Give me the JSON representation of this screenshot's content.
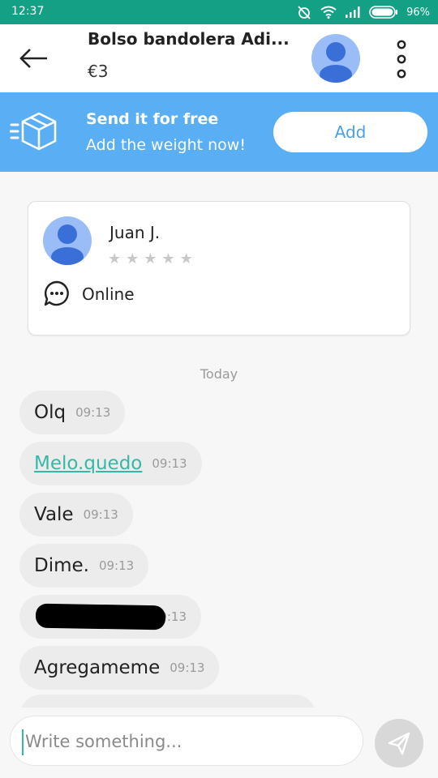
{
  "status_bar": {
    "time": "12:37",
    "battery": "96%"
  },
  "header": {
    "title": "Bolso bandolera Adi...",
    "price": "€3"
  },
  "promo": {
    "title": "Send it for free",
    "subtitle": "Add the weight now!",
    "button": "Add"
  },
  "seller": {
    "name": "Juan J.",
    "status": "Online",
    "stars": [
      "★",
      "★",
      "★",
      "★",
      "★"
    ]
  },
  "chat": {
    "date_label": "Today",
    "messages": [
      {
        "text": "Olq",
        "time": "09:13",
        "link": false
      },
      {
        "text": "Melo.quedo",
        "time": "09:13",
        "link": true
      },
      {
        "text": "Vale",
        "time": "09:13",
        "link": false
      },
      {
        "text": "Dime.",
        "time": "09:13",
        "link": false
      },
      {
        "text": "",
        "time": "9:13",
        "link": false
      },
      {
        "text": "Agregameme",
        "time": "09:13",
        "link": false
      }
    ]
  },
  "composer": {
    "placeholder": "Write something..."
  }
}
